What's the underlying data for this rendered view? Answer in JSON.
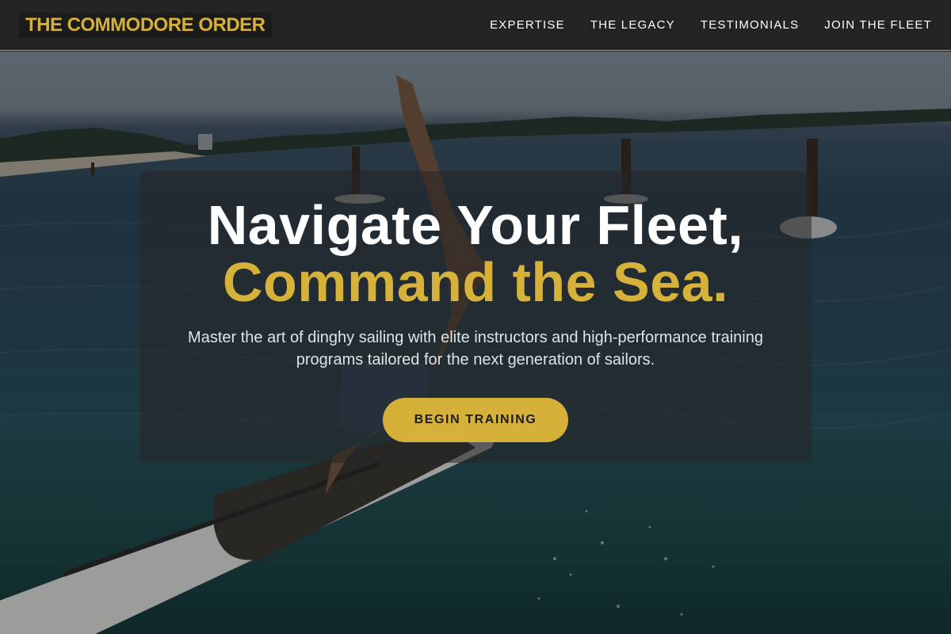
{
  "brand": {
    "name": "THE COMMODORE ORDER",
    "color": "#d6b13a"
  },
  "nav": {
    "items": [
      {
        "label": "EXPERTISE"
      },
      {
        "label": "THE LEGACY"
      },
      {
        "label": "TESTIMONIALS"
      },
      {
        "label": "JOIN THE FLEET"
      }
    ]
  },
  "hero": {
    "headline_line1": "Navigate Your Fleet,",
    "headline_line2": "Command the Sea.",
    "subtext": "Master the art of dinghy sailing with elite instructors and high-performance training programs tailored for the next generation of sailors.",
    "cta_label": "BEGIN TRAINING",
    "accent_color": "#d7b23a"
  }
}
